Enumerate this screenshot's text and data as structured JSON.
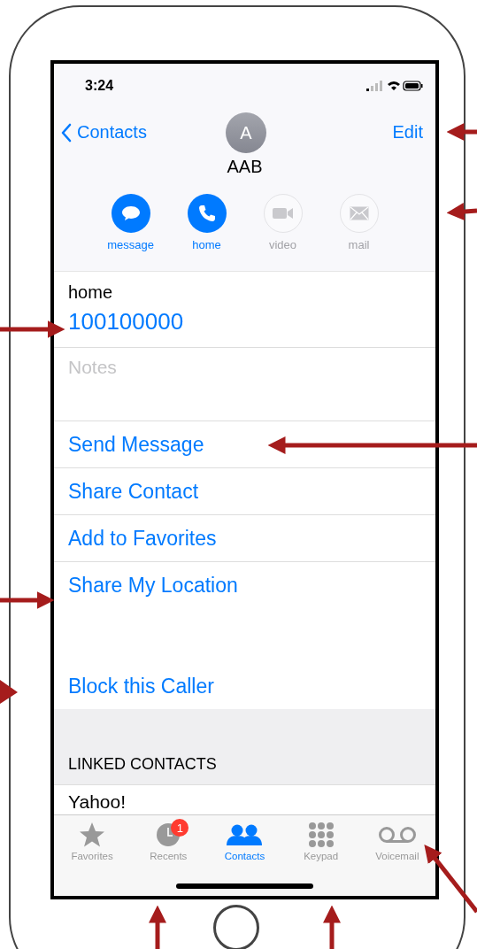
{
  "status_bar": {
    "time": "3:24"
  },
  "nav": {
    "back": "Contacts",
    "edit": "Edit",
    "avatar_initial": "A",
    "name": "AAB"
  },
  "actions": [
    {
      "kind": "message",
      "label": "message",
      "enabled": true
    },
    {
      "kind": "phone",
      "label": "home",
      "enabled": true
    },
    {
      "kind": "video",
      "label": "video",
      "enabled": false
    },
    {
      "kind": "mail",
      "label": "mail",
      "enabled": false
    }
  ],
  "phone": {
    "label": "home",
    "number": "100100000"
  },
  "notes": {
    "placeholder": "Notes"
  },
  "options": [
    "Send Message",
    "Share Contact",
    "Add to Favorites",
    "Share My Location"
  ],
  "block": "Block this Caller",
  "linked": {
    "heading": "LINKED CONTACTS",
    "items": [
      "Yahoo!"
    ]
  },
  "tabs": [
    {
      "kind": "star",
      "label": "Favorites",
      "selected": false
    },
    {
      "kind": "clock",
      "label": "Recents",
      "selected": false,
      "badge": "1"
    },
    {
      "kind": "people",
      "label": "Contacts",
      "selected": true
    },
    {
      "kind": "keypad",
      "label": "Keypad",
      "selected": false
    },
    {
      "kind": "voicemail",
      "label": "Voicemail",
      "selected": false
    }
  ]
}
